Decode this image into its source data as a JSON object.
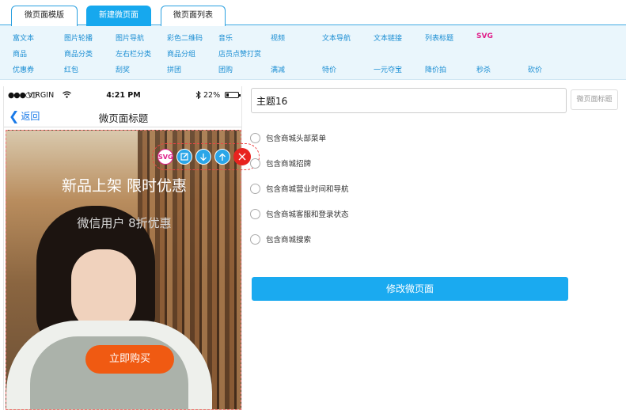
{
  "tabs": [
    {
      "label": "微页面模版"
    },
    {
      "label": "新建微页面",
      "active": true
    },
    {
      "label": "微页面列表"
    }
  ],
  "toolbar": {
    "row1": [
      "富文本",
      "图片轮播",
      "图片导航",
      "彩色二维码",
      "音乐",
      "视频",
      "文本导航",
      "文本链接",
      "列表标题",
      "SVG"
    ],
    "row2": [
      "商品",
      "商品分类",
      "左右栏分类",
      "商品分组",
      "店员点赞打赏"
    ],
    "row3": [
      "优惠券",
      "红包",
      "刮奖",
      "拼团",
      "团购",
      "满减",
      "特价",
      "一元夺宝",
      "降价拍",
      "秒杀",
      "砍价"
    ]
  },
  "phone": {
    "carrier": "VIRGIN",
    "time": "4:21 PM",
    "battery_pct": "22%",
    "battery_level": 0.22,
    "back_label": "返回",
    "page_title": "微页面标题",
    "headline": "新品上架 限时优惠",
    "subline": "微信用户 8折优惠",
    "buy_label": "立即购买",
    "ctrl_svg": "SVG"
  },
  "form": {
    "title_value": "主题16",
    "title_button": "微页面标题",
    "options": [
      "包含商城头部菜单",
      "包含商城招牌",
      "包含商城营业时间和导航",
      "包含商城客服和登录状态",
      "包含商城搜索"
    ],
    "submit_label": "修改微页面"
  },
  "colors": {
    "accent": "#16a8ee",
    "buy": "#f05a12",
    "delete": "#e8231f",
    "svg": "#e0208a"
  }
}
